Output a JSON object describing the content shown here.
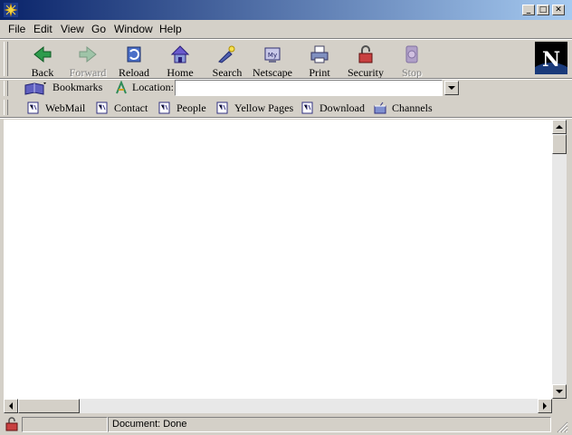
{
  "window": {
    "app_icon": "netscape-star-icon",
    "controls": {
      "minimize": "_",
      "maximize": "□",
      "close": "✕"
    }
  },
  "menu": [
    "File",
    "Edit",
    "View",
    "Go",
    "Window",
    "Help"
  ],
  "toolbar": {
    "back": "Back",
    "forward": "Forward",
    "reload": "Reload",
    "home": "Home",
    "search": "Search",
    "netscape": "Netscape",
    "print": "Print",
    "security": "Security",
    "stop": "Stop"
  },
  "logo": {
    "letter": "N"
  },
  "location_bar": {
    "bookmarks_label": "Bookmarks",
    "location_label": "Location:",
    "url_value": ""
  },
  "personal_toolbar": [
    "WebMail",
    "Contact",
    "People",
    "Yellow Pages",
    "Download",
    "Channels"
  ],
  "status": {
    "text": "Document: Done"
  },
  "colors": {
    "titlebar_start": "#0a246a",
    "titlebar_end": "#a6caf0",
    "chrome": "#d4d0c8"
  }
}
